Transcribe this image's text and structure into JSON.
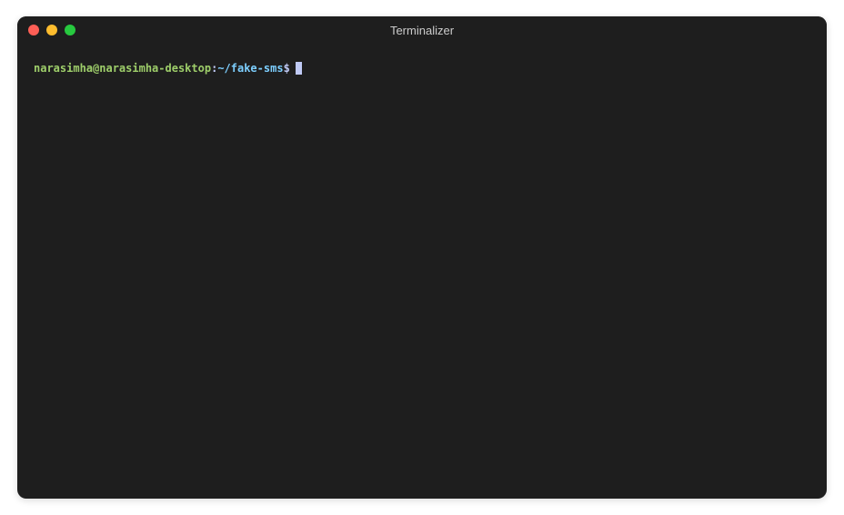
{
  "window": {
    "title": "Terminalizer"
  },
  "prompt": {
    "user_host": "narasimha@narasimha-desktop",
    "colon": ":",
    "path": "~/fake-sms",
    "dollar": "$",
    "command": ""
  }
}
